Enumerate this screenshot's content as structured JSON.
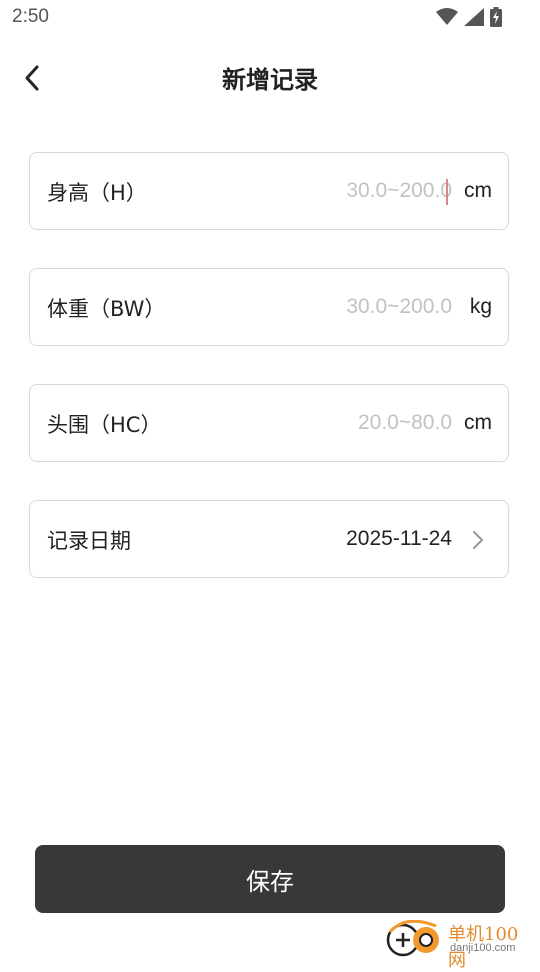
{
  "status_bar": {
    "time": "2:50",
    "icons": [
      "wifi-icon",
      "signal-icon",
      "battery-charging-icon"
    ]
  },
  "header": {
    "back_icon": "chevron-left-icon",
    "title": "新增记录"
  },
  "fields": {
    "height": {
      "label": "身高（H）",
      "value": "",
      "placeholder": "30.0~200.0",
      "unit": "cm",
      "focused": true
    },
    "weight": {
      "label": "体重（BW）",
      "value": "",
      "placeholder": "30.0~200.0",
      "unit": "kg"
    },
    "head": {
      "label": "头围（HC）",
      "value": "",
      "placeholder": "20.0~80.0",
      "unit": "cm"
    },
    "date": {
      "label": "记录日期",
      "value": "2025-11-24",
      "icon": "chevron-right-icon"
    }
  },
  "save_button": {
    "label": "保存"
  },
  "watermark": {
    "name": "单机100网",
    "url": "danji100.com"
  },
  "colors": {
    "button_bg": "#383838",
    "placeholder": "#c2c2c2",
    "border": "#d9d9d9",
    "caret": "#d88888",
    "watermark": "#e58a2e"
  }
}
